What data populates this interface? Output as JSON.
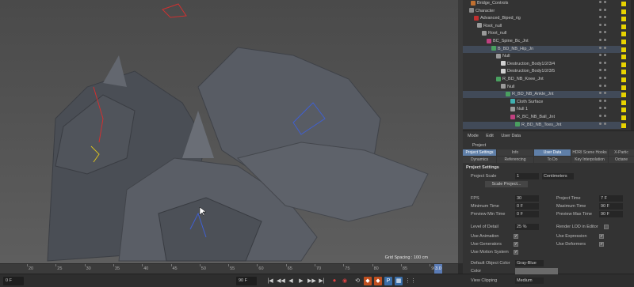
{
  "viewport": {
    "status_text": "Grid Spacing : 100 cm"
  },
  "timeline": {
    "ticks": [
      "20",
      "25",
      "30",
      "35",
      "40",
      "45",
      "50",
      "55",
      "60",
      "65",
      "70",
      "75",
      "80",
      "85",
      "90"
    ],
    "current_frame": "3.0"
  },
  "transport": {
    "frame_start": "0 F",
    "frame_end": "90 F",
    "buttons": [
      "|◀",
      "◀◀",
      "◀",
      "▶",
      "▶▶",
      "▶|",
      "⏺",
      "◉",
      "⟲",
      "◆",
      "◆",
      "P",
      "▦",
      "⋮⋮"
    ]
  },
  "object_manager": {
    "rows": [
      {
        "label": "Bridge_Controls",
        "indent": 6,
        "icon_color": "#c07030",
        "sel": false
      },
      {
        "label": "Character",
        "indent": 4,
        "icon_color": "#8a8a8a",
        "sel": false
      },
      {
        "label": "Advanced_Biped_rig",
        "indent": 10,
        "icon_color": "#c03030",
        "sel": false
      },
      {
        "label": "Root_null",
        "indent": 14,
        "icon_color": "#9a9a9a",
        "sel": false
      },
      {
        "label": "Root_null",
        "indent": 20,
        "icon_color": "#9a9a9a",
        "sel": false
      },
      {
        "label": "BC_Spine_Bc_Jnt",
        "indent": 26,
        "icon_color": "#c04080",
        "sel": false
      },
      {
        "label": "B_BD_NB_Hip_Jn",
        "indent": 32,
        "icon_color": "#4aa060",
        "sel": true
      },
      {
        "label": "Null",
        "indent": 38,
        "icon_color": "#9a9a9a",
        "sel": false
      },
      {
        "label": "Destruction_Body1/2/3/4",
        "indent": 44,
        "icon_color": "#d0d0d0",
        "sel": false
      },
      {
        "label": "Destruction_Body1/2/3/5",
        "indent": 44,
        "icon_color": "#d0d0d0",
        "sel": false
      },
      {
        "label": "R_BD_NB_Knee_Jnt",
        "indent": 38,
        "icon_color": "#4aa060",
        "sel": false
      },
      {
        "label": "Null",
        "indent": 44,
        "icon_color": "#9a9a9a",
        "sel": false
      },
      {
        "label": "R_BD_NB_Ankle_Jnt",
        "indent": 50,
        "icon_color": "#4aa060",
        "sel": true
      },
      {
        "label": "Cloth Surface",
        "indent": 56,
        "icon_color": "#40b0b0",
        "sel": false
      },
      {
        "label": "Null 1",
        "indent": 56,
        "icon_color": "#9a9a9a",
        "sel": false
      },
      {
        "label": "R_BC_NB_Ball_Jnt",
        "indent": 56,
        "icon_color": "#c04080",
        "sel": false
      },
      {
        "label": "R_BD_NB_Toes_Jnt",
        "indent": 62,
        "icon_color": "#4aa060",
        "sel": true
      }
    ]
  },
  "attribute_manager": {
    "menu": [
      "Mode",
      "Edit",
      "User Data"
    ],
    "title": "Project",
    "tabs_row1": [
      "Project Settings",
      "Info",
      "User Data",
      "HDRI Scene Hooks",
      "X-Partic"
    ],
    "tabs_row2": [
      "Dynamics",
      "Referencing",
      "To Do",
      "Key Interpolation",
      "Octane"
    ],
    "section": "Project Settings",
    "project_scale_label": "Project Scale",
    "project_scale_value": "1",
    "project_scale_unit": "Centimeters",
    "scale_button": "Scale Project...",
    "fps_label": "FPS",
    "fps_value": "30",
    "project_time_label": "Project Time",
    "project_time_value": "7 F",
    "min_time_label": "Minimum Time",
    "min_time_value": "0 F",
    "max_time_label": "Maximum Time",
    "max_time_value": "90 F",
    "prev_min_label": "Preview Min Time",
    "prev_min_value": "0 F",
    "prev_max_label": "Preview Max Time",
    "prev_max_value": "90 F",
    "lod_label": "Level of Detail",
    "lod_value": "25 %",
    "render_lod_label": "Render LOD in Editor",
    "use_animation_label": "Use Animation",
    "use_expression_label": "Use Expression",
    "use_generators_label": "Use Generators",
    "use_deformers_label": "Use Deformers",
    "use_motion_label": "Use Motion System",
    "default_color_label": "Default Object Color",
    "default_color_value": "Gray-Blue",
    "color_label": "Color",
    "view_clipping_label": "View Clipping",
    "view_clipping_value": "Medium"
  }
}
